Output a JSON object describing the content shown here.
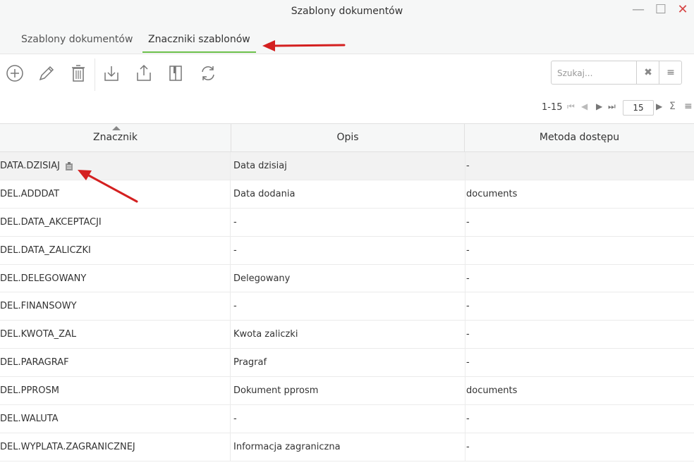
{
  "window": {
    "title": "Szablony dokumentów",
    "minimize_label": "—",
    "maximize_label": "☐",
    "close_label": "✕"
  },
  "tabs": [
    {
      "label": "Szablony dokumentów",
      "active": false
    },
    {
      "label": "Znaczniki szablonów",
      "active": true
    }
  ],
  "toolbar": {
    "icons": [
      "add-icon",
      "edit-icon",
      "delete-icon",
      "import-icon",
      "export-icon",
      "columns-icon",
      "refresh-icon"
    ]
  },
  "search": {
    "placeholder": "Szukaj...",
    "clear_label": "✖",
    "menu_label": "≡"
  },
  "pager": {
    "range": "1-15",
    "page_size": "15",
    "first_label": "⏮",
    "prev_label": "◀",
    "next_label": "▶",
    "last_label": "⏭",
    "next2_label": "▶",
    "sum_label": "Σ",
    "menu_label": "≡"
  },
  "table": {
    "columns": [
      "Znacznik",
      "Opis",
      "Metoda dostępu"
    ],
    "rows": [
      {
        "tag": "DATA.DZISIAJ",
        "desc": "Data dzisiaj",
        "access": "-"
      },
      {
        "tag": "DEL.ADDDAT",
        "desc": "Data dodania",
        "access": "documents"
      },
      {
        "tag": "DEL.DATA_AKCEPTACJI",
        "desc": "-",
        "access": "-"
      },
      {
        "tag": "DEL.DATA_ZALICZKI",
        "desc": "-",
        "access": "-"
      },
      {
        "tag": "DEL.DELEGOWANY",
        "desc": "Delegowany",
        "access": "-"
      },
      {
        "tag": "DEL.FINANSOWY",
        "desc": "-",
        "access": "-"
      },
      {
        "tag": "DEL.KWOTA_ZAL",
        "desc": "Kwota zaliczki",
        "access": "-"
      },
      {
        "tag": "DEL.PARAGRAF",
        "desc": "Pragraf",
        "access": "-"
      },
      {
        "tag": "DEL.PPROSM",
        "desc": "Dokument pprosm",
        "access": "documents"
      },
      {
        "tag": "DEL.WALUTA",
        "desc": "-",
        "access": "-"
      },
      {
        "tag": "DEL.WYPLATA.ZAGRANICZNEJ",
        "desc": "Informacja zagraniczna",
        "access": "-"
      }
    ]
  },
  "colors": {
    "active_tab_underline": "#6cc04a",
    "annotation_arrow": "#d42020"
  }
}
